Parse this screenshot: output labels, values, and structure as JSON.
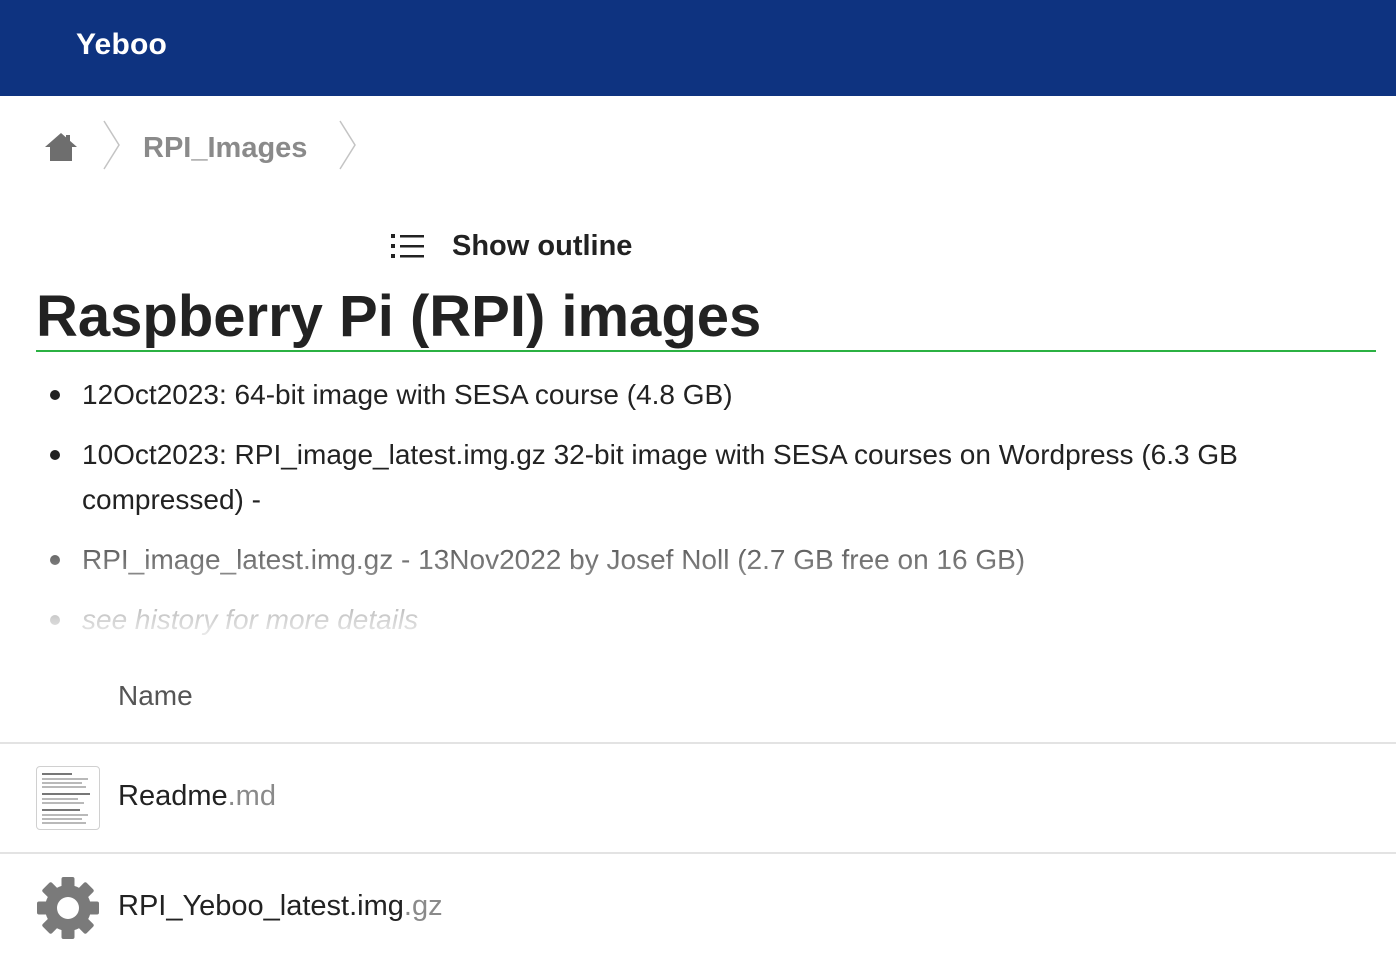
{
  "header": {
    "brand": "Yeboo"
  },
  "breadcrumb": {
    "home_icon": "home-icon",
    "items": [
      {
        "label": "RPI_Images"
      }
    ]
  },
  "toolbar": {
    "outline_icon": "list-icon",
    "outline_label": "Show outline"
  },
  "readme": {
    "title": "Raspberry Pi (RPI) images",
    "items": [
      "12Oct2023: 64-bit image with SESA course (4.8 GB)",
      "10Oct2023: RPI_image_latest.img.gz 32-bit image with SESA courses on Wordpress  (6.3 GB compressed) -",
      "RPI_image_latest.img.gz - 13Nov2022 by Josef Noll (2.7 GB free on 16 GB)",
      "see history for more details"
    ]
  },
  "file_list": {
    "columns": {
      "name": "Name"
    },
    "files": [
      {
        "base": "Readme",
        "ext": ".md",
        "icon": "document-thumbnail"
      },
      {
        "base": "RPI_Yeboo_latest.img",
        "ext": ".gz",
        "icon": "gear-icon"
      }
    ]
  },
  "colors": {
    "topbar": "#0e3380",
    "title_underline": "#2bb143",
    "muted_text": "#8a8a8a"
  }
}
